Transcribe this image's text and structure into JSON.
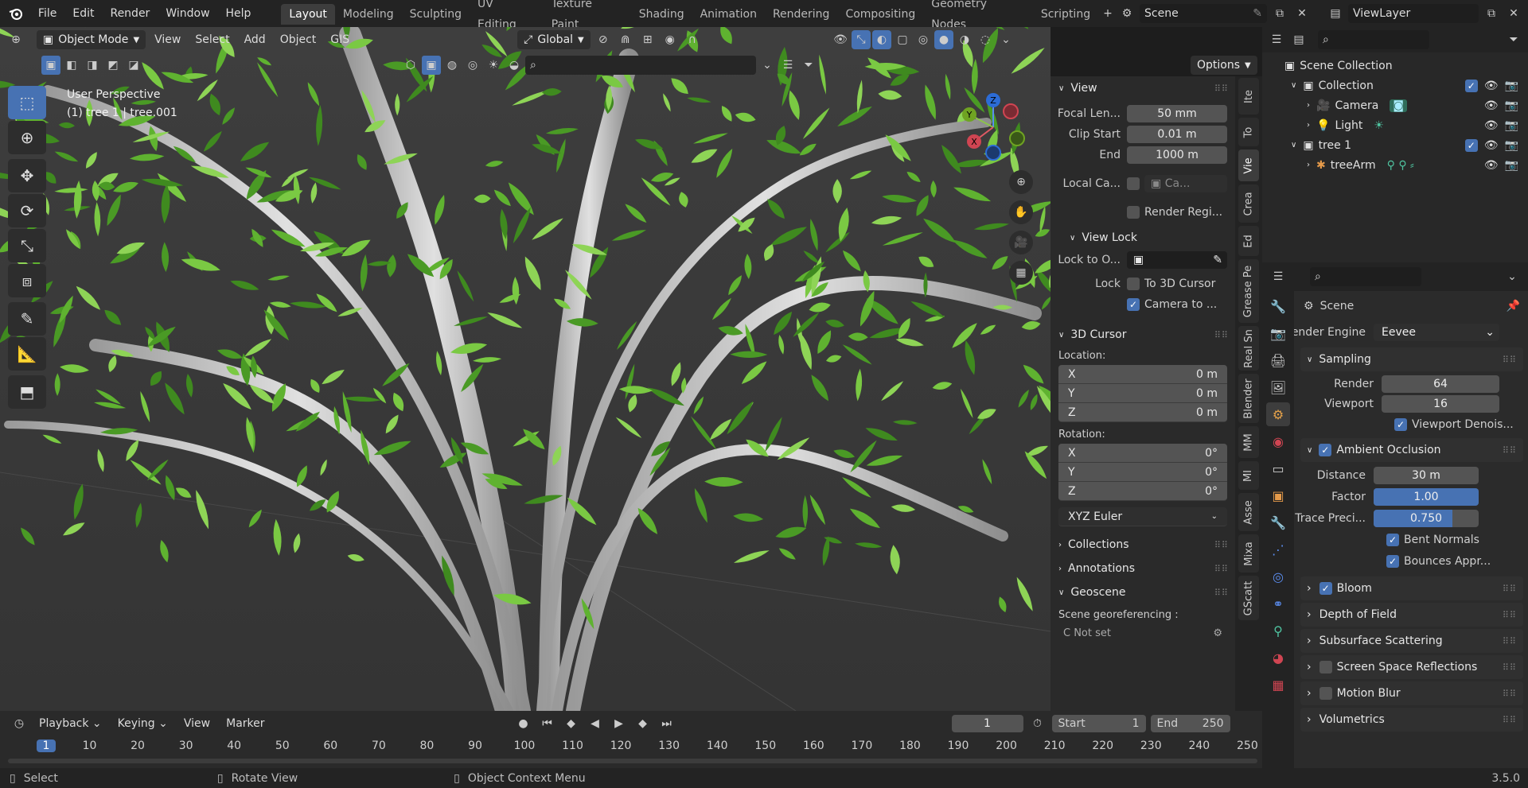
{
  "topbar": {
    "menus": [
      "File",
      "Edit",
      "Render",
      "Window",
      "Help"
    ],
    "workspaces": [
      "Layout",
      "Modeling",
      "Sculpting",
      "UV Editing",
      "Texture Paint",
      "Shading",
      "Animation",
      "Rendering",
      "Compositing",
      "Geometry Nodes",
      "Scripting"
    ],
    "active_workspace": "Layout",
    "scene": "Scene",
    "view_layer": "ViewLayer"
  },
  "viewport_header": {
    "mode": "Object Mode",
    "menus": [
      "View",
      "Select",
      "Add",
      "Object",
      "GIS"
    ],
    "orientation": "Global",
    "options_label": "Options"
  },
  "viewport": {
    "perspective": "User Perspective",
    "object_info": "(1) tree 1 | tree.001",
    "gizmo_axes": {
      "x": "X",
      "y": "Y",
      "z": "Z"
    }
  },
  "npanel": {
    "view_title": "View",
    "focal_label": "Focal Len...",
    "focal_value": "50 mm",
    "clip_start_label": "Clip Start",
    "clip_start_value": "0.01 m",
    "clip_end_label": "End",
    "clip_end_value": "1000 m",
    "local_cam_label": "Local Ca...",
    "local_cam_value": "Ca...",
    "render_region_label": "Render Regi...",
    "view_lock_title": "View Lock",
    "lock_to_label": "Lock to O...",
    "lock_label": "Lock",
    "to_3d_cursor": "To 3D Cursor",
    "camera_to": "Camera to ...",
    "cursor_title": "3D Cursor",
    "location_label": "Location:",
    "location": [
      {
        "axis": "X",
        "value": "0 m"
      },
      {
        "axis": "Y",
        "value": "0 m"
      },
      {
        "axis": "Z",
        "value": "0 m"
      }
    ],
    "rotation_label": "Rotation:",
    "rotation": [
      {
        "axis": "X",
        "value": "0°"
      },
      {
        "axis": "Y",
        "value": "0°"
      },
      {
        "axis": "Z",
        "value": "0°"
      }
    ],
    "rotation_mode": "XYZ Euler",
    "collections_title": "Collections",
    "annotations_title": "Annotations",
    "geoscene_title": "Geoscene",
    "georef_label": "Scene georeferencing :",
    "georef_value": "C  Not set"
  },
  "vtabs": [
    "Ite",
    "To",
    "Vie",
    "Crea",
    "Ed",
    "Grease Pe",
    "Real Sn",
    "Blender",
    "MM",
    "MI",
    "Asse",
    "Mixa",
    "GScatt"
  ],
  "timeline": {
    "menus": [
      "Playback",
      "Keying",
      "View",
      "Marker"
    ],
    "current_frame": "1",
    "start_label": "Start",
    "start_value": "1",
    "end_label": "End",
    "end_value": "250",
    "ticks": [
      "1",
      "10",
      "20",
      "30",
      "40",
      "50",
      "60",
      "70",
      "80",
      "90",
      "100",
      "110",
      "120",
      "130",
      "140",
      "150",
      "160",
      "170",
      "180",
      "190",
      "200",
      "210",
      "220",
      "230",
      "240",
      "250"
    ]
  },
  "statusbar": {
    "select": "Select",
    "rotate": "Rotate View",
    "context": "Object Context Menu",
    "version": "3.5.0"
  },
  "outliner": {
    "root": "Scene Collection",
    "collection": "Collection",
    "camera": "Camera",
    "light": "Light",
    "tree": "tree 1",
    "arm": "treeArm"
  },
  "properties": {
    "context": "Scene",
    "render_engine_label": "Render Engine",
    "render_engine": "Eevee",
    "sampling_title": "Sampling",
    "render_label": "Render",
    "render_value": "64",
    "viewport_label": "Viewport",
    "viewport_value": "16",
    "viewport_denoise": "Viewport Denois...",
    "ao_title": "Ambient Occlusion",
    "distance_label": "Distance",
    "distance_value": "30 m",
    "factor_label": "Factor",
    "factor_value": "1.00",
    "factor_fill": 1.0,
    "trace_label": "Trace Preci...",
    "trace_value": "0.750",
    "trace_fill": 0.75,
    "bent_normals": "Bent Normals",
    "bounces": "Bounces Appr...",
    "sections": [
      "Bloom",
      "Depth of Field",
      "Subsurface Scattering",
      "Screen Space Reflections",
      "Motion Blur",
      "Volumetrics"
    ]
  },
  "colors": {
    "accent": "#4772b3",
    "leaf_light": "#7ac943",
    "leaf_dark": "#3f8a1f",
    "bark": "#c9c9c9"
  }
}
